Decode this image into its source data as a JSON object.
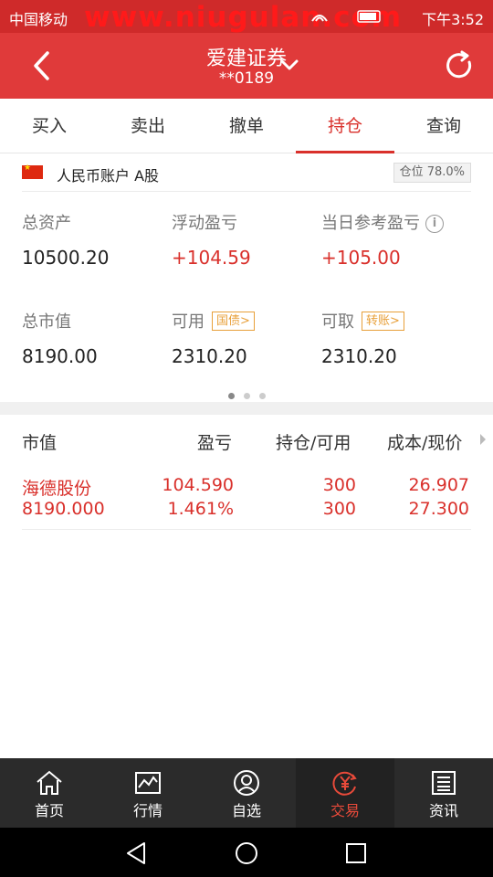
{
  "status_bar": {
    "carrier": "中国移动",
    "watermark": "www.niugulan.com",
    "time": "下午3:52"
  },
  "header": {
    "title": "爱建证券",
    "account_mask": "**0189"
  },
  "tabs": [
    {
      "label": "买入"
    },
    {
      "label": "卖出"
    },
    {
      "label": "撤单"
    },
    {
      "label": "持仓",
      "active": true
    },
    {
      "label": "查询"
    }
  ],
  "account": {
    "label": "人民币账户 A股",
    "position_badge": "仓位 78.0%"
  },
  "summary": {
    "total_assets_label": "总资产",
    "total_assets": "10500.20",
    "floating_pl_label": "浮动盈亏",
    "floating_pl": "+104.59",
    "daily_pl_label": "当日参考盈亏",
    "daily_pl": "+105.00",
    "market_value_label": "总市值",
    "market_value": "8190.00",
    "available_label": "可用",
    "available_tag": "国债>",
    "available": "2310.20",
    "withdrawable_label": "可取",
    "withdrawable_tag": "转账>",
    "withdrawable": "2310.20"
  },
  "holdings_header": {
    "col1": "市值",
    "col2": "盈亏",
    "col3": "持仓/可用",
    "col4": "成本/现价"
  },
  "holdings": [
    {
      "name": "海德股份",
      "market_value": "8190.000",
      "pl": "104.590",
      "pl_pct": "1.461%",
      "position": "300",
      "available": "300",
      "cost": "26.907",
      "price": "27.300"
    }
  ],
  "bottom_nav": [
    {
      "label": "首页",
      "icon": "home-icon"
    },
    {
      "label": "行情",
      "icon": "chart-icon"
    },
    {
      "label": "自选",
      "icon": "user-icon"
    },
    {
      "label": "交易",
      "icon": "yuan-icon",
      "active": true
    },
    {
      "label": "资讯",
      "icon": "news-icon"
    }
  ],
  "colors": {
    "brand_red": "#e03a3a",
    "gain_red": "#d9302b",
    "tag_orange": "#e8a03a"
  }
}
